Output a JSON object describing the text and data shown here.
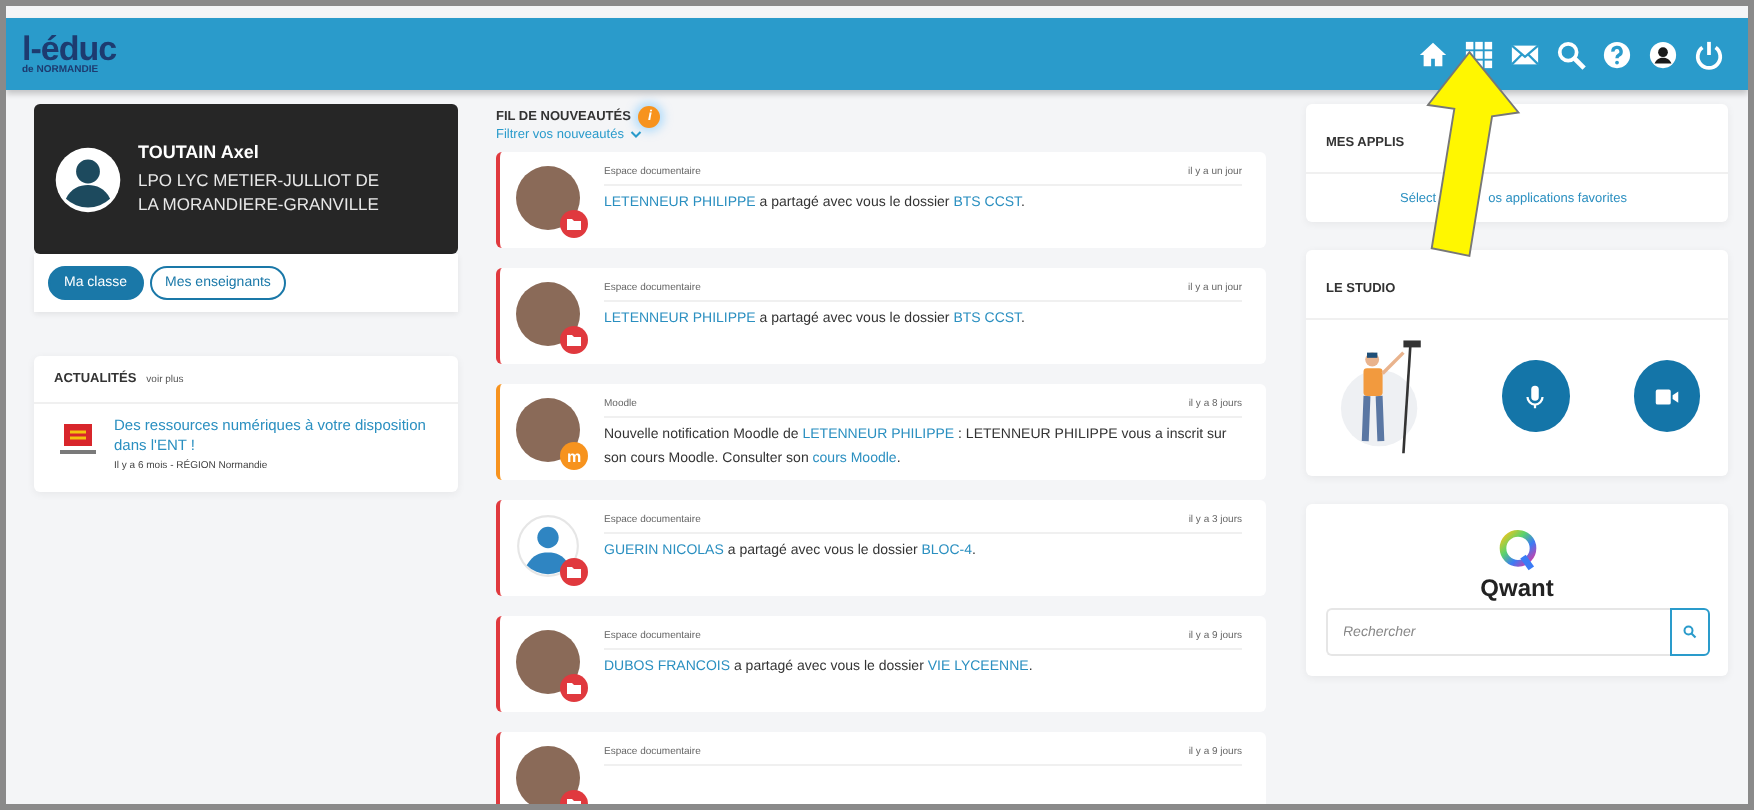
{
  "header": {
    "logo": "l-éduc",
    "logo_sub": "de NORMANDIE"
  },
  "profile": {
    "name": "TOUTAIN Axel",
    "school": "LPO LYC METIER-JULLIOT DE LA MORANDIERE-GRANVILLE"
  },
  "profile_buttons": [
    {
      "label": "Ma classe",
      "selected": true
    },
    {
      "label": "Mes enseignants",
      "selected": false
    }
  ],
  "news": {
    "title": "ACTUALITÉS",
    "more": "voir plus",
    "items": [
      {
        "title": "Des ressources numériques à votre disposition dans l'ENT !",
        "meta": "Il y a 6 mois - RÉGION Normandie"
      }
    ]
  },
  "feed": {
    "title": "FIL DE NOUVEAUTÉS",
    "info": "i",
    "filter": "Filtrer vos nouveautés",
    "items": [
      {
        "kind": "document",
        "avatar": {
          "kind": "photo"
        },
        "source": "Espace documentaire",
        "time": "il y a un jour",
        "parts": [
          {
            "text": "LETENNEUR PHILIPPE",
            "link": true
          },
          {
            "text": " a partagé avec vous le dossier ",
            "link": false
          },
          {
            "text": "BTS CCST",
            "link": true
          },
          {
            "text": ".",
            "link": false
          }
        ]
      },
      {
        "kind": "document",
        "avatar": {
          "kind": "photo"
        },
        "source": "Espace documentaire",
        "time": "il y a un jour",
        "parts": [
          {
            "text": "LETENNEUR PHILIPPE",
            "link": true
          },
          {
            "text": " a partagé avec vous le dossier ",
            "link": false
          },
          {
            "text": "BTS CCST",
            "link": true
          },
          {
            "text": ".",
            "link": false
          }
        ]
      },
      {
        "kind": "moodle",
        "badge": "m",
        "avatar": {
          "kind": "photo"
        },
        "source": "Moodle",
        "time": "il y a 8 jours",
        "parts": [
          {
            "text": "Nouvelle notification Moodle de ",
            "link": false
          },
          {
            "text": "LETENNEUR PHILIPPE",
            "link": true
          },
          {
            "text": " : LETENNEUR PHILIPPE vous a inscrit sur son cours Moodle. Consulter son ",
            "link": false
          },
          {
            "text": "cours Moodle",
            "link": true
          },
          {
            "text": ".",
            "link": false
          }
        ]
      },
      {
        "kind": "document",
        "avatar": {
          "kind": "user"
        },
        "source": "Espace documentaire",
        "time": "il y a 3 jours",
        "parts": [
          {
            "text": "GUERIN NICOLAS",
            "link": true
          },
          {
            "text": " a partagé avec vous le dossier ",
            "link": false
          },
          {
            "text": "BLOC-4",
            "link": true
          },
          {
            "text": ".",
            "link": false
          }
        ]
      },
      {
        "kind": "document",
        "avatar": {
          "kind": "photo"
        },
        "source": "Espace documentaire",
        "time": "il y a 9 jours",
        "parts": [
          {
            "text": "DUBOS FRANCOIS",
            "link": true
          },
          {
            "text": " a partagé avec vous le dossier ",
            "link": false
          },
          {
            "text": "VIE LYCEENNE",
            "link": true
          },
          {
            "text": ".",
            "link": false
          }
        ]
      },
      {
        "kind": "document",
        "avatar": {
          "kind": "photo"
        },
        "source": "Espace documentaire",
        "time": "il y a 9 jours"
      }
    ]
  },
  "apps": {
    "title": "MES APPLIS",
    "hint_parts": [
      "Sélect",
      "os applications favorites"
    ]
  },
  "studio": {
    "title": "LE STUDIO"
  },
  "qwant": {
    "logo": "Qwant",
    "placeholder": "Rechercher"
  }
}
